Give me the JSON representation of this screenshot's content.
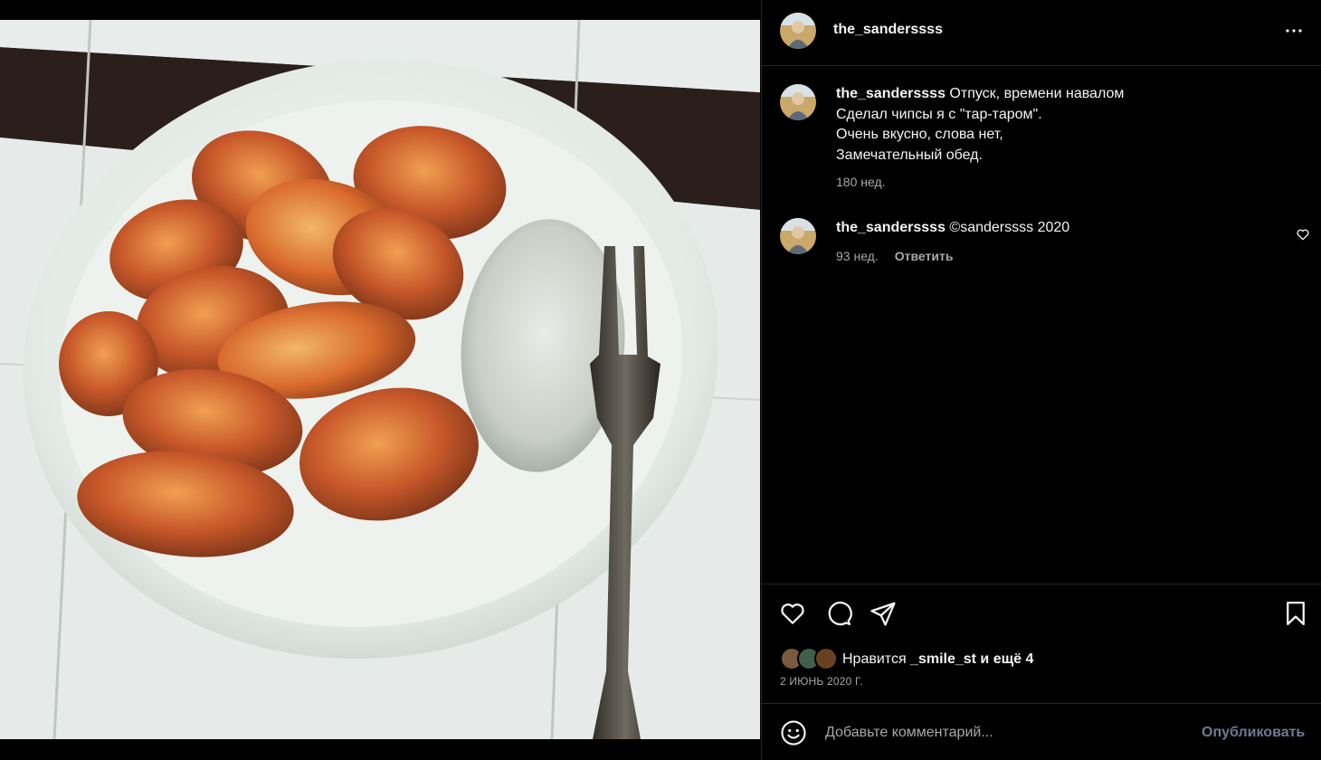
{
  "post": {
    "photo_icon": "photo-of-fried-potato-chips-with-tartar-sauce-and-fork",
    "author": "the_sanderssss",
    "menu_icon": "more-horizontal-icon"
  },
  "caption": {
    "author": "the_sanderssss",
    "lines": [
      "Отпуск, времени навалом",
      "Сделал чипсы я с \"тар-таром\".",
      "Очень вкусно, слова нет,",
      "Замечательный обед."
    ],
    "time": "180 нед."
  },
  "comment": {
    "author": "the_sanderssss",
    "text": "©sanderssss 2020",
    "time": "93 нед.",
    "reply_label": "Ответить",
    "like_icon": "heart-small-icon"
  },
  "actions": {
    "like_icon": "heart-icon",
    "comment_icon": "comment-bubble-icon",
    "share_icon": "paper-plane-icon",
    "save_icon": "bookmark-icon"
  },
  "likes": {
    "prefix": "Нравится ",
    "user": "_smile_st",
    "suffix": " и ещё 4"
  },
  "date": "2 ИЮНЬ 2020 Г.",
  "composer": {
    "emoji_icon": "smiley-icon",
    "placeholder": "Добавьте комментарий...",
    "post_label": "Опубликовать"
  },
  "colors": {
    "background": "#000000",
    "text": "#f5f5f5",
    "secondary": "#a8a8a8",
    "divider": "#262626",
    "post_button_disabled": "#6e7a94"
  }
}
